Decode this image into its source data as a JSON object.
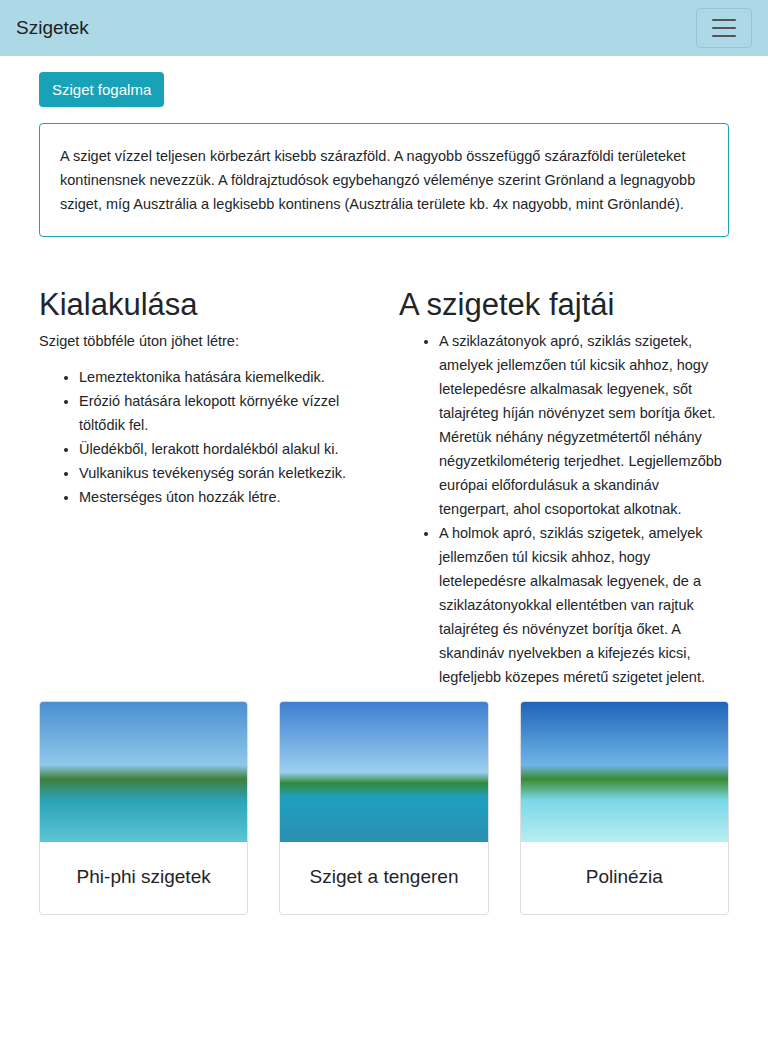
{
  "navbar": {
    "brand": "Szigetek"
  },
  "definition": {
    "button": "Sziget fogalma",
    "text": "A sziget vízzel teljesen körbezárt kisebb szárazföld. A nagyobb összefüggő szárazföldi területeket kontinensnek nevezzük. A földrajztudósok egybehangzó véleménye szerint Grönland a legnagyobb sziget, míg Ausztrália a legkisebb kontinens (Ausztrália területe kb. 4x nagyobb, mint Grönlandé)."
  },
  "formation": {
    "title": "Kialakulása",
    "intro": "Sziget többféle úton jöhet létre:",
    "items": [
      "Lemeztektonika hatására kiemelkedik.",
      "Erózió hatására lekopott környéke vízzel töltődik fel.",
      "Üledékből, lerakott hordalékból alakul ki.",
      "Vulkanikus tevékenység során keletkezik.",
      "Mesterséges úton hozzák létre."
    ]
  },
  "types": {
    "title": "A szigetek fajtái",
    "items": [
      "A sziklazátonyok apró, sziklás szigetek, amelyek jellemzően túl kicsik ahhoz, hogy letelepedésre alkalmasak legyenek, sőt talajréteg híján növényzet sem borítja őket. Méretük néhány négyzetmétertől néhány négyzetkilométerig terjedhet. Legjellemzőbb európai előfordulásuk a skandináv tengerpart, ahol csoportokat alkotnak.",
      "A holmok apró, sziklás szigetek, amelyek jellemzően túl kicsik ahhoz, hogy letelepedésre alkalmasak legyenek, de a sziklazátonyokkal ellentétben van rajtuk talajréteg és növényzet borítja őket. A skandináv nyelvekben a kifejezés kicsi, legfeljebb közepes méretű szigetet jelent."
    ]
  },
  "cards": [
    {
      "title": "Phi-phi szigetek"
    },
    {
      "title": "Sziget a tengeren"
    },
    {
      "title": "Polinézia"
    }
  ]
}
